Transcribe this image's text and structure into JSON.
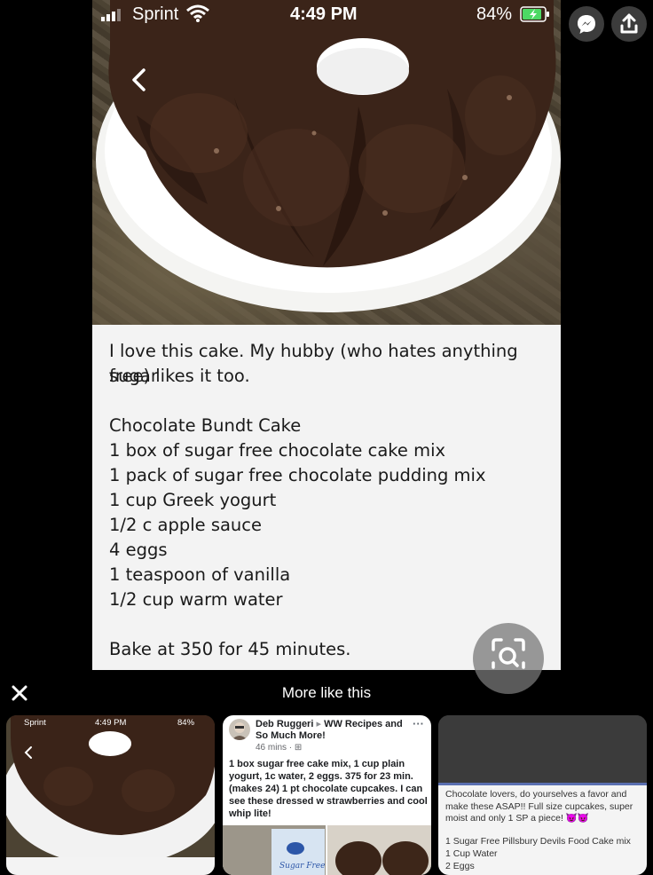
{
  "status_bar": {
    "carrier": "Sprint",
    "time": "4:49 PM",
    "battery": "84%"
  },
  "recipe": {
    "intro_line1": "I love this cake. My hubby (who hates anything sugar",
    "intro_line2": "free) likes it too.",
    "title": "Chocolate Bundt Cake",
    "ingredients": [
      "1 box of sugar free chocolate cake mix",
      "1 pack of sugar free chocolate pudding mix",
      "1 cup Greek yogurt",
      "1/2 c apple sauce",
      "4 eggs",
      "1 teaspoon of vanilla",
      "1/2 cup warm water"
    ],
    "bake": "Bake at 350 for 45 minutes."
  },
  "icons": {
    "back": "chevron-left-icon",
    "message": "chat-bubble-icon",
    "share": "share-upload-icon",
    "visual_search": "visual-search-icon",
    "close": "close-icon"
  },
  "more_like_this": {
    "title": "More like this",
    "cards": [
      {
        "status_carrier": "Sprint",
        "status_time": "4:49 PM",
        "status_battery": "84%"
      },
      {
        "author": "Deb Ruggeri",
        "group": "WW Recipes and So Much More!",
        "time": "46 mins ·",
        "body": "1 box sugar free cake mix, 1 cup plain yogurt, 1c water, 2 eggs. 375 for 23 min. (makes 24) 1 pt chocolate cupcakes. I can see these dressed w strawberries and cool whip lite!",
        "image_text": "Sugar Free"
      },
      {
        "text1": "Chocolate lovers, do yourselves a favor and make these ASAP!! Full size cupcakes, super moist and only 1 SP a piece!",
        "line2": "1 Sugar Free Pillsbury Devils Food Cake mix",
        "line3": "1 Cup Water",
        "line4": "2 Eggs"
      }
    ]
  }
}
